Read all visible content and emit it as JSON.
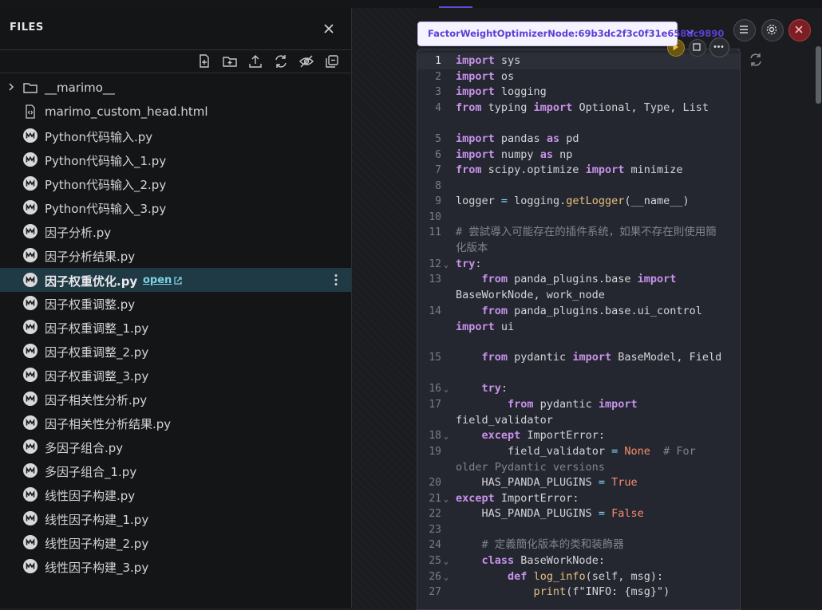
{
  "sidebar": {
    "title": "FILES",
    "files": [
      {
        "name": "__marimo__",
        "type": "folder"
      },
      {
        "name": "marimo_custom_head.html",
        "type": "html"
      },
      {
        "name": "Python代码输入.py",
        "type": "marimo"
      },
      {
        "name": "Python代码输入_1.py",
        "type": "marimo"
      },
      {
        "name": "Python代码输入_2.py",
        "type": "marimo"
      },
      {
        "name": "Python代码输入_3.py",
        "type": "marimo"
      },
      {
        "name": "因子分析.py",
        "type": "marimo"
      },
      {
        "name": "因子分析结果.py",
        "type": "marimo"
      },
      {
        "name": "因子权重优化.py",
        "type": "marimo",
        "selected": true,
        "open_label": "open"
      },
      {
        "name": "因子权重调整.py",
        "type": "marimo"
      },
      {
        "name": "因子权重调整_1.py",
        "type": "marimo"
      },
      {
        "name": "因子权重调整_2.py",
        "type": "marimo"
      },
      {
        "name": "因子权重调整_3.py",
        "type": "marimo"
      },
      {
        "name": "因子相关性分析.py",
        "type": "marimo"
      },
      {
        "name": "因子相关性分析结果.py",
        "type": "marimo"
      },
      {
        "name": "多因子组合.py",
        "type": "marimo"
      },
      {
        "name": "多因子组合_1.py",
        "type": "marimo"
      },
      {
        "name": "线性因子构建.py",
        "type": "marimo"
      },
      {
        "name": "线性因子构建_1.py",
        "type": "marimo"
      },
      {
        "name": "线性因子构建_2.py",
        "type": "marimo"
      },
      {
        "name": "线性因子构建_3.py",
        "type": "marimo"
      }
    ]
  },
  "cell": {
    "tooltip": "FactorWeightOptimizerNode:69b3dc2f3c0f31e658dc9890",
    "line_numbers": [
      "1",
      "2",
      "3",
      "4",
      "5",
      "6",
      "7",
      "8",
      "9",
      "10",
      "11",
      "12",
      "13",
      "14",
      "15",
      "16",
      "17",
      "18",
      "19",
      "20",
      "21",
      "22",
      "23",
      "24",
      "25",
      "26",
      "27"
    ],
    "code_lines": [
      "import sys",
      "import os",
      "import logging",
      "from typing import Optional, Type, List",
      "import pandas as pd",
      "import numpy as np",
      "from scipy.optimize import minimize",
      "",
      "logger = logging.getLogger(__name__)",
      "",
      "# 尝試導入可能存在的插件系统，如果不存在則使用簡化版本",
      "try:",
      "    from panda_plugins.base import BaseWorkNode, work_node",
      "    from panda_plugins.base.ui_control import ui",
      "    from pydantic import BaseModel, Field",
      "    try:",
      "        from pydantic import field_validator",
      "    except ImportError:",
      "        field_validator = None  # For older Pydantic versions",
      "    HAS_PANDA_PLUGINS = True",
      "except ImportError:",
      "    HAS_PANDA_PLUGINS = False",
      "",
      "    # 定義簡化版本的类和装飾器",
      "    class BaseWorkNode:",
      "        def log_info(self, msg):",
      "            print(f\"INFO: {msg}\")"
    ]
  },
  "colors": {
    "accent": "#5b4fd9",
    "selected_row": "#1f3a44",
    "keyword": "#c792ea",
    "function": "#e5c07b",
    "constant": "#f78c6c",
    "close_button": "#7a1f24"
  }
}
